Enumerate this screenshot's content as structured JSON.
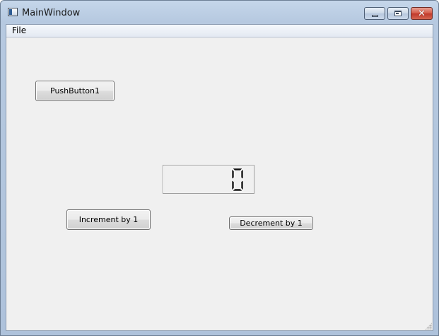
{
  "window": {
    "title": "MainWindow",
    "icon": "window-app-icon",
    "controls": {
      "minimize": "minimize-icon",
      "maximize": "maximize-icon",
      "close": "close-icon",
      "close_glyph": "✕"
    }
  },
  "menubar": {
    "items": [
      {
        "label": "File"
      }
    ]
  },
  "buttons": {
    "push_button_1": "PushButton1",
    "increment": "Increment by 1",
    "decrement": "Decrement by 1"
  },
  "lcd": {
    "value": "0"
  },
  "colors": {
    "titlebar": "#b6c9e0",
    "client_background": "#f0f0f0",
    "close_button": "#c0392b"
  }
}
